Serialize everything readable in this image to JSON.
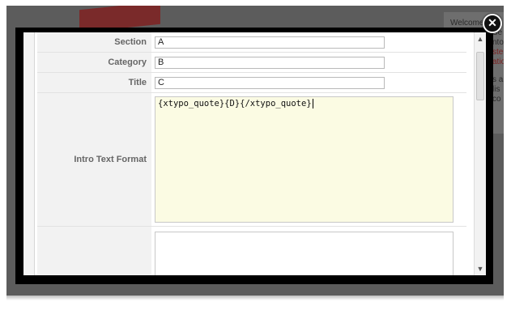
{
  "background": {
    "panel_lines": [
      "Welcome",
      "Se",
      "nto",
      "ste",
      "atio",
      "s a",
      "lis",
      "co"
    ]
  },
  "modal": {
    "close_icon": "close-icon",
    "form": {
      "section_label": "Section",
      "section_value": "A",
      "category_label": "Category",
      "category_value": "B",
      "title_label": "Title",
      "title_value": "C",
      "intro_label": "Intro Text Format",
      "intro_value": "{xtypo_quote}{D}{/xtypo_quote}"
    },
    "scrollbar": {
      "up_icon": "chevron-up-icon",
      "down_icon": "chevron-down-icon"
    }
  },
  "colors": {
    "overlay": "#5c5c5c",
    "modal_frame": "#000000",
    "textarea_bg": "#fbfbe3",
    "label_bg": "#f2f2f2"
  }
}
